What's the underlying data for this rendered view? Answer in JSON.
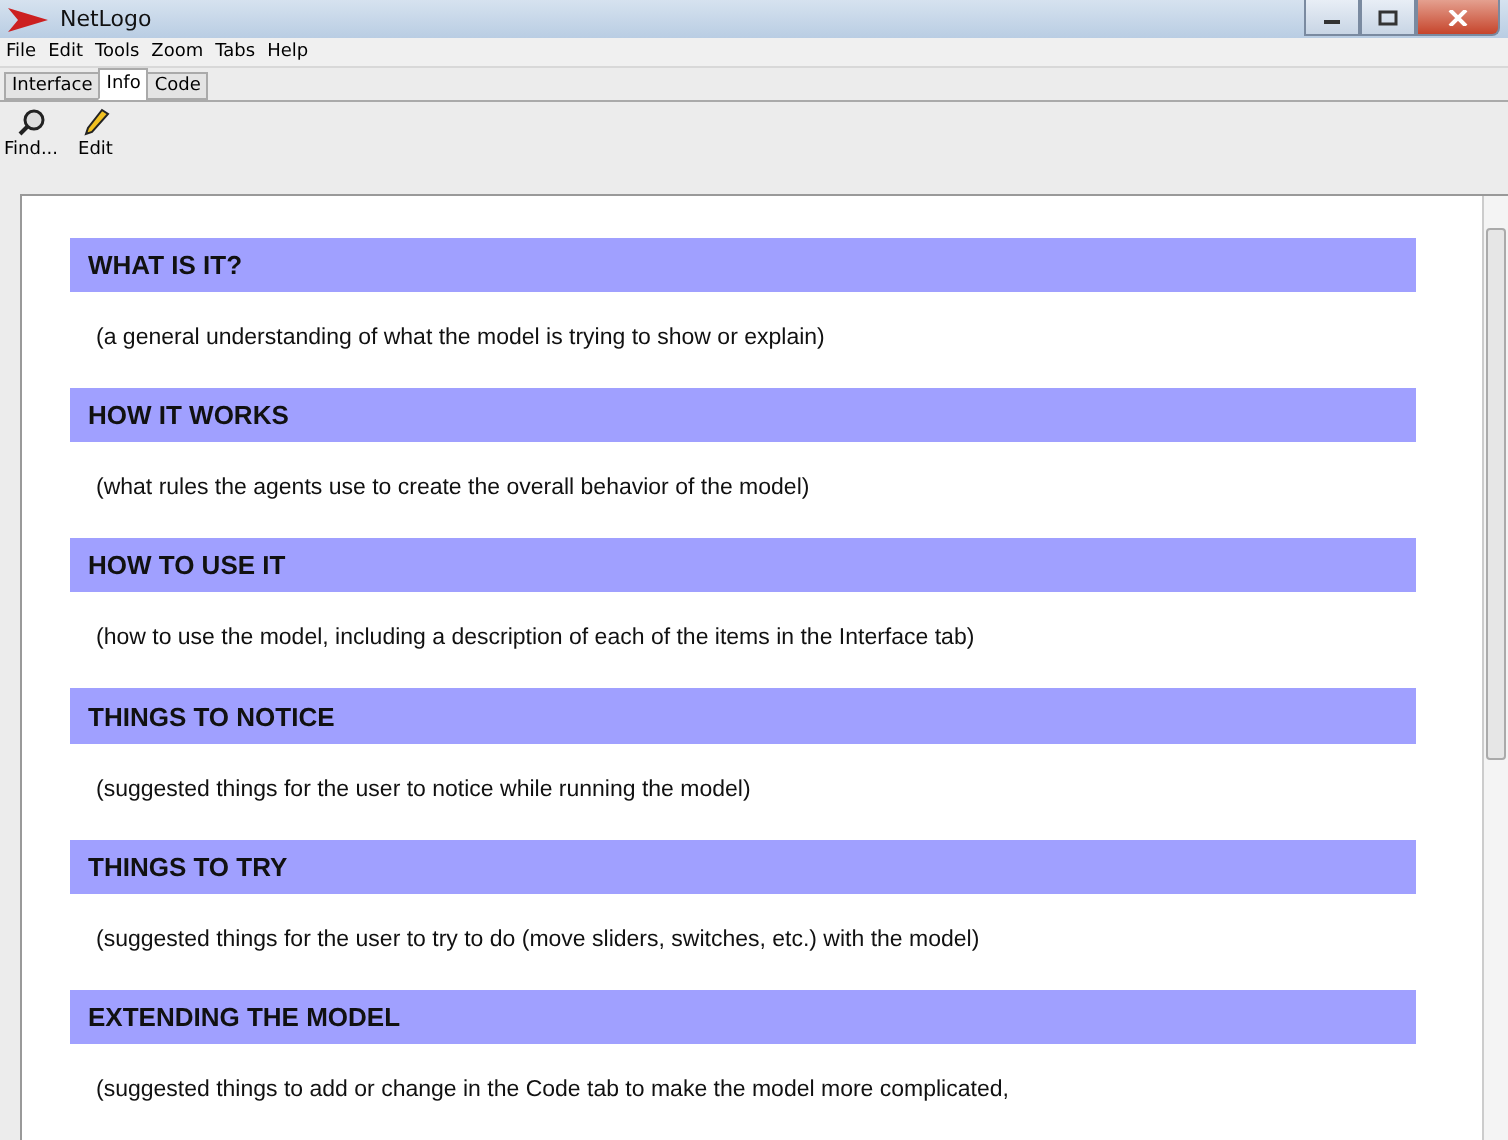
{
  "window": {
    "title": "NetLogo"
  },
  "menu": [
    "File",
    "Edit",
    "Tools",
    "Zoom",
    "Tabs",
    "Help"
  ],
  "tabs": [
    {
      "label": "Interface",
      "selected": false
    },
    {
      "label": "Info",
      "selected": true
    },
    {
      "label": "Code",
      "selected": false
    }
  ],
  "toolbar": [
    {
      "label": "Find...",
      "kind": "find"
    },
    {
      "label": "Edit",
      "kind": "edit"
    }
  ],
  "sections": [
    {
      "heading": "WHAT IS IT?",
      "text": "(a general understanding of what the model is trying to show or explain)"
    },
    {
      "heading": "HOW IT WORKS",
      "text": "(what rules the agents use to create the overall behavior of the model)"
    },
    {
      "heading": "HOW TO USE IT",
      "text": "(how to use the model, including a description of each of the items in the Interface tab)"
    },
    {
      "heading": "THINGS TO NOTICE",
      "text": "(suggested things for the user to notice while running the model)"
    },
    {
      "heading": "THINGS TO TRY",
      "text": "(suggested things for the user to try to do (move sliders, switches, etc.) with the model)"
    },
    {
      "heading": "EXTENDING THE MODEL",
      "text": "(suggested things to add or change in the Code tab to make the model more complicated,"
    }
  ]
}
